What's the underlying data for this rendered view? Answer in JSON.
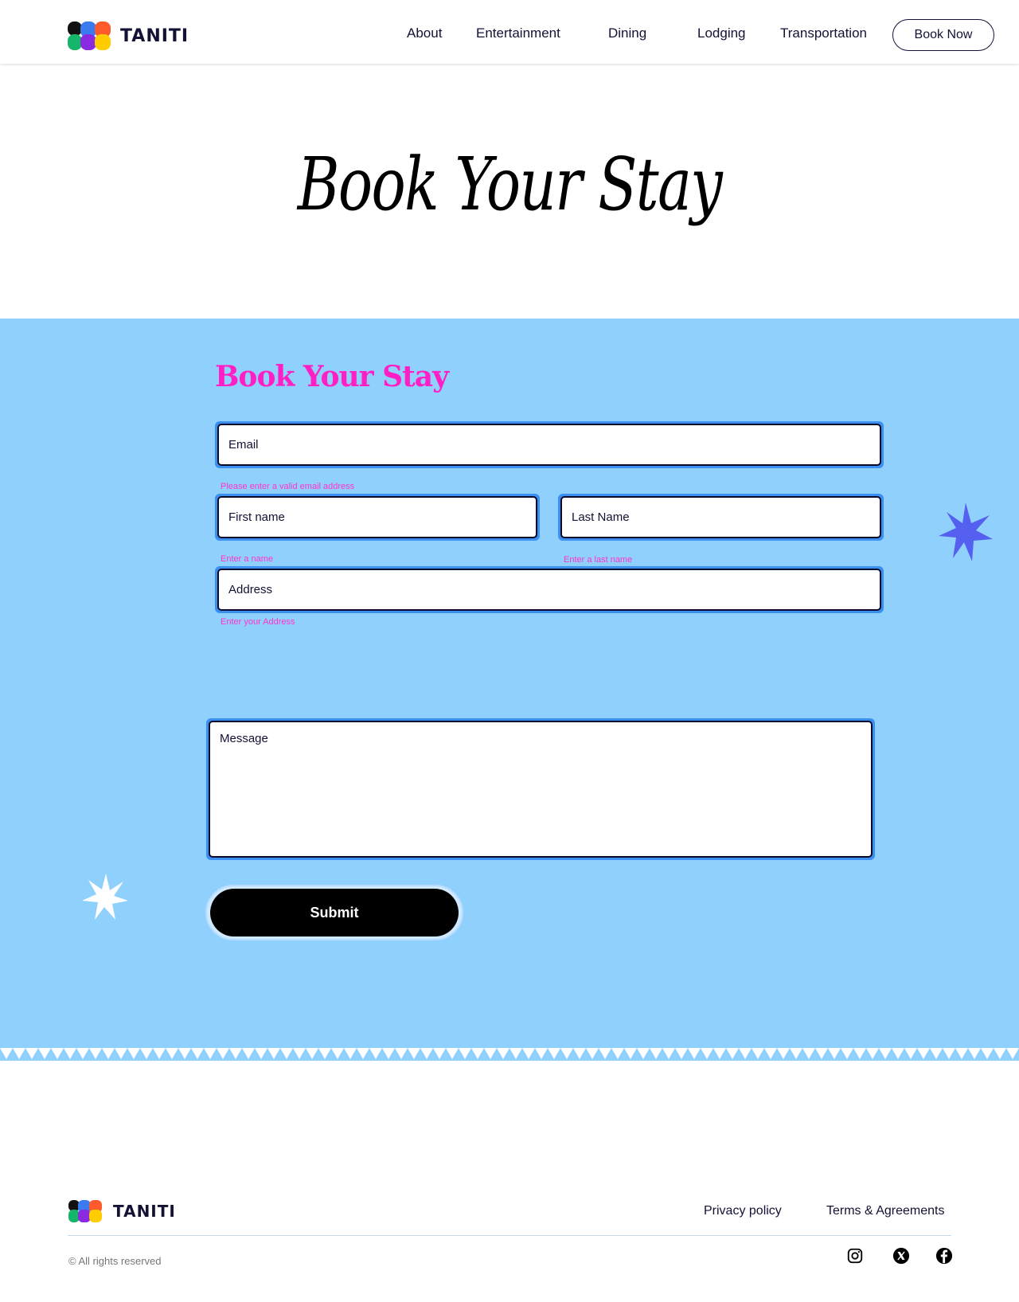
{
  "header": {
    "brand": "TANITI",
    "nav": [
      "About",
      "Entertainment",
      "Dining",
      "Lodging",
      "Transportation"
    ],
    "cta": "Book Now"
  },
  "hero": {
    "title": "Book Your Stay"
  },
  "form": {
    "title": "Book Your Stay",
    "email": {
      "placeholder": "Email",
      "error": "Please enter a valid email address"
    },
    "first_name": {
      "placeholder": "First name",
      "error": "Enter a name"
    },
    "last_name": {
      "placeholder": "Last Name",
      "error": "Enter a last name"
    },
    "address": {
      "placeholder": "Address",
      "error": "Enter your Address"
    },
    "message": {
      "placeholder": "Message"
    },
    "submit": "Submit"
  },
  "footer": {
    "brand": "TANITI",
    "links": [
      "Privacy policy",
      "Terms & Agreements"
    ],
    "copyright": "© All rights reserved",
    "social": [
      "instagram-icon",
      "x-icon",
      "facebook-icon"
    ]
  },
  "colors": {
    "section_bg": "#90d0fc",
    "accent_pink": "#ff1fc4",
    "field_ring": "#3a8ff0",
    "star_blue": "#5560f0"
  }
}
